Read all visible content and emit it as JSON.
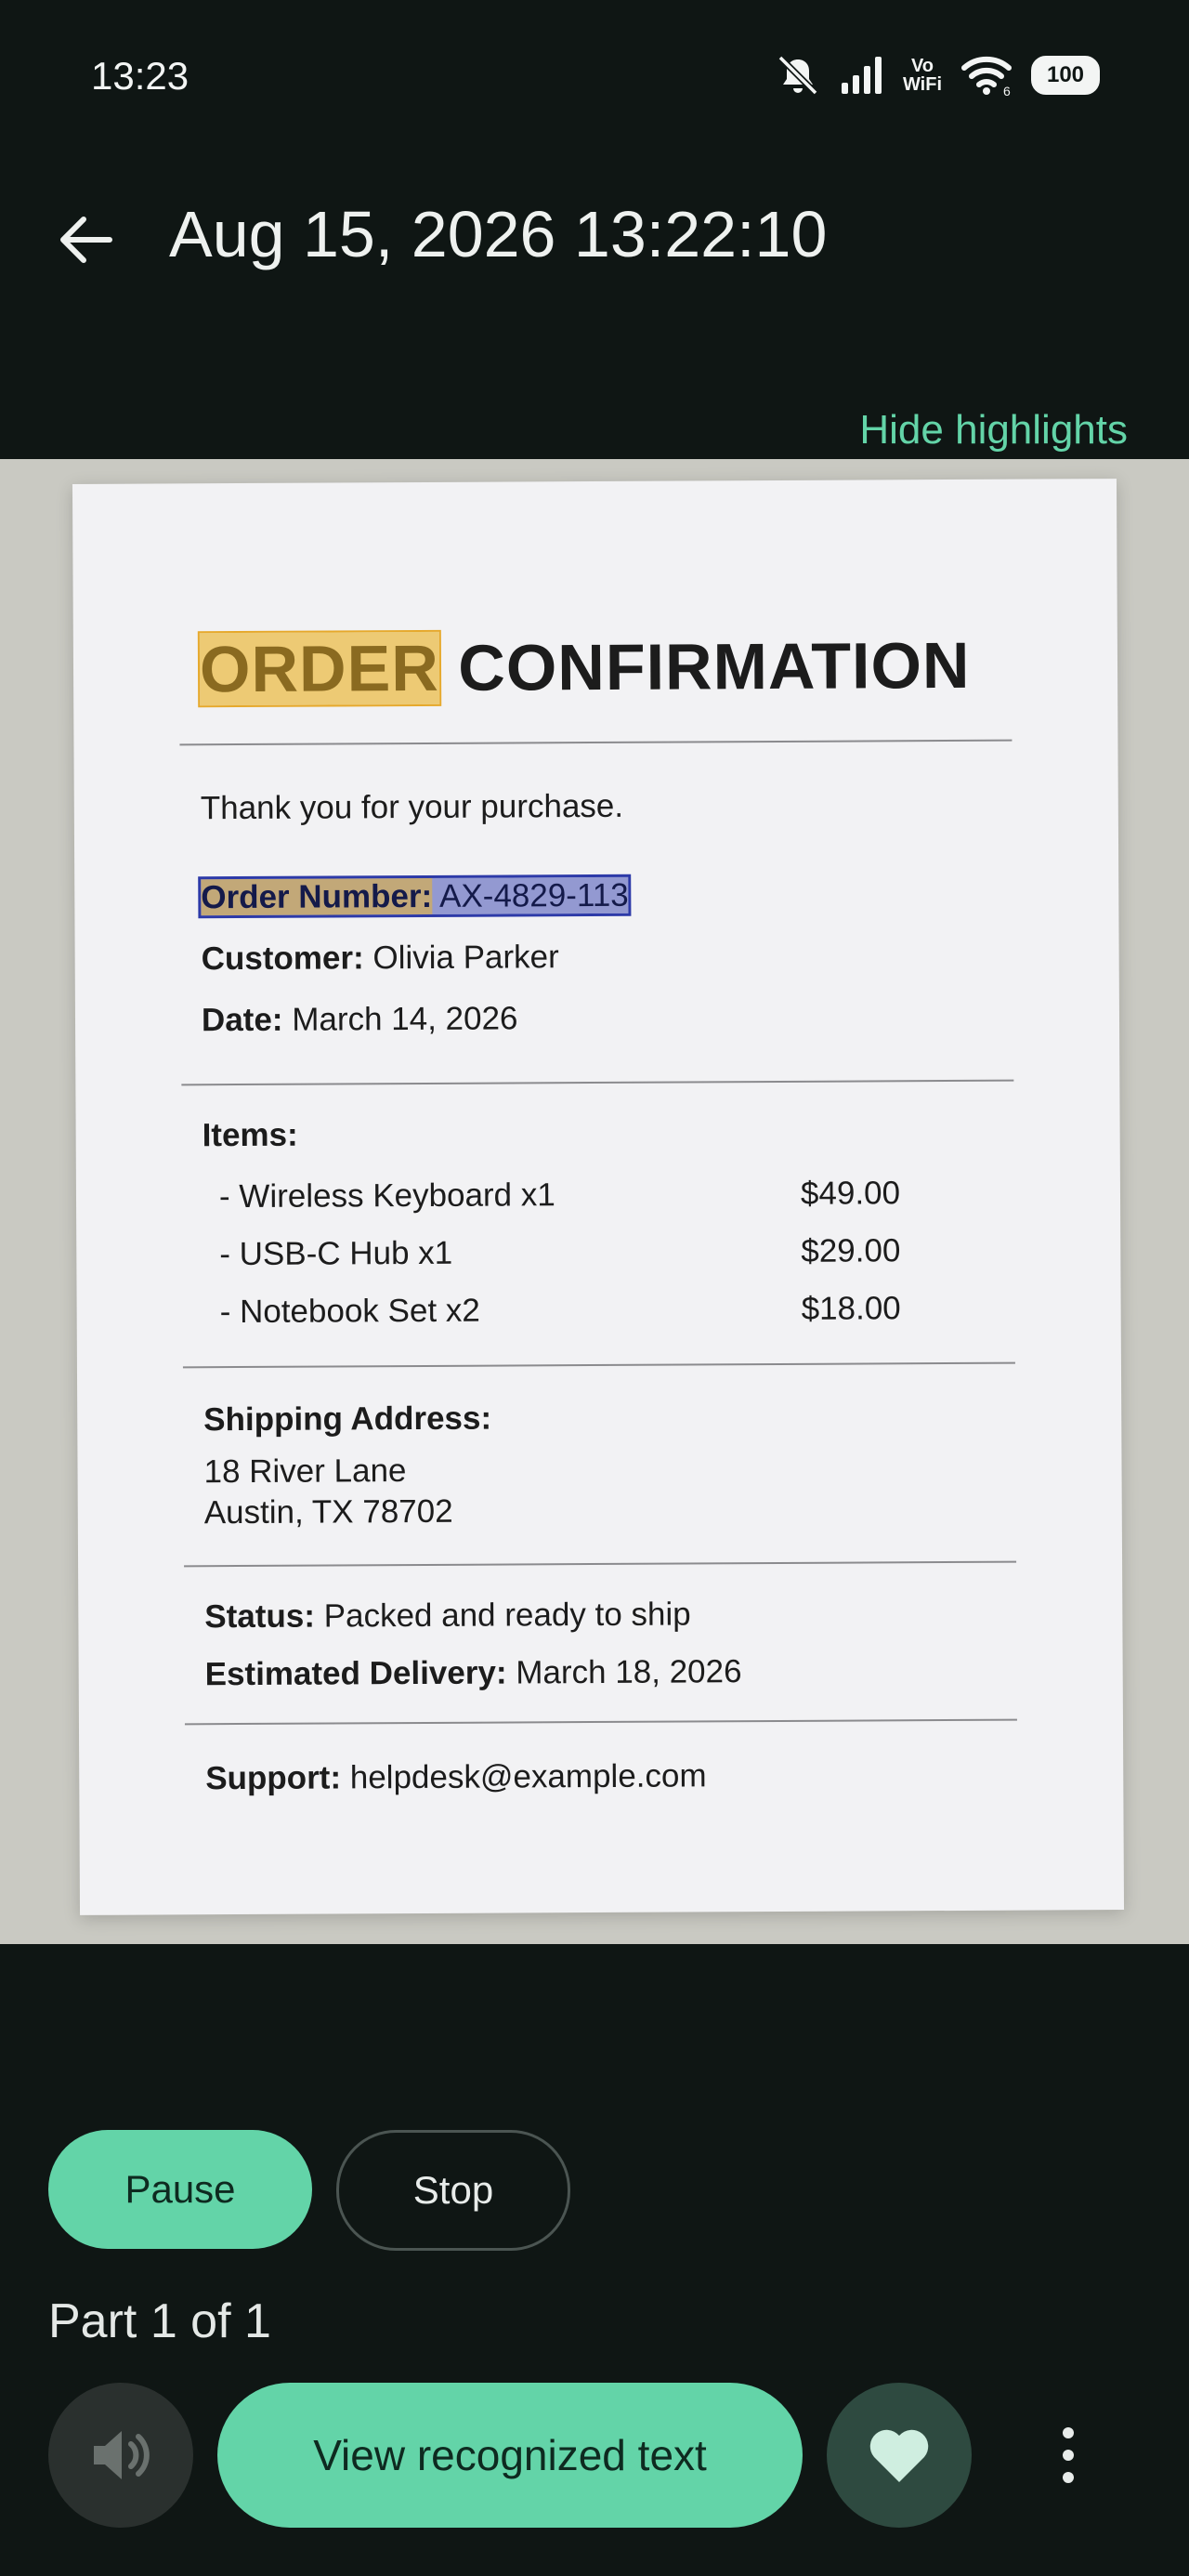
{
  "status_bar": {
    "time": "13:23",
    "battery": "100",
    "wifi_label_top": "Vo",
    "wifi_label_bottom": "WiFi",
    "wifi_sub": "6"
  },
  "app_bar": {
    "title": "Aug 15, 2026 13:22:10",
    "back_icon": "arrow-left-icon"
  },
  "actions": {
    "hide_highlights": "Hide highlights"
  },
  "document": {
    "heading_word1": "ORDER",
    "heading_word2": "CONFIRMATION",
    "thanks": "Thank you for your purchase.",
    "order_number_label": "Order Number:",
    "order_number_value": "AX-4829-113",
    "customer_label": "Customer:",
    "customer_value": "Olivia Parker",
    "date_label": "Date:",
    "date_value": "March 14, 2026",
    "items_label": "Items:",
    "items": [
      {
        "name": "- Wireless Keyboard x1",
        "price": "$49.00"
      },
      {
        "name": "- USB-C Hub x1",
        "price": "$29.00"
      },
      {
        "name": "- Notebook Set x2",
        "price": "$18.00"
      }
    ],
    "shipping_label": "Shipping Address:",
    "address_line1": "18 River Lane",
    "address_line2": "Austin, TX 78702",
    "status_label": "Status:",
    "status_value": "Packed and ready to ship",
    "delivery_label": "Estimated Delivery:",
    "delivery_value": "March 18, 2026",
    "support_label": "Support:",
    "support_value": "helpdesk@example.com"
  },
  "controls": {
    "pause": "Pause",
    "stop": "Stop",
    "part": "Part 1 of 1",
    "view_text": "View recognized text",
    "speaker_icon": "speaker-icon",
    "heart_icon": "heart-icon",
    "more_icon": "more-vertical-icon"
  },
  "colors": {
    "accent": "#63d4a8",
    "background": "#0f1614",
    "highlight_orange": "#eab430",
    "highlight_blue": "#2d3aa8"
  }
}
